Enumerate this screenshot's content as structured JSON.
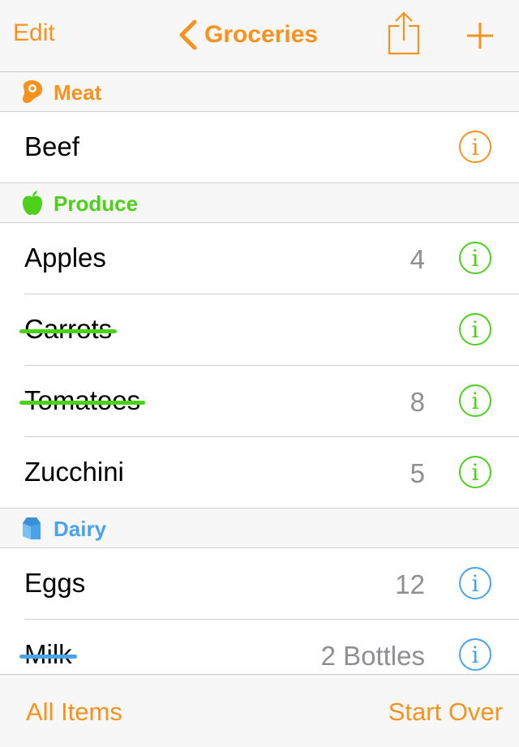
{
  "navbar": {
    "edit_label": "Edit",
    "back_icon": "chevron-left-icon",
    "title": "Groceries",
    "share_icon": "share-icon",
    "add_icon": "plus-icon"
  },
  "colors": {
    "accent": "#f7921e",
    "meat": "#f7921e",
    "produce": "#4cd01a",
    "dairy": "#4aa3e8",
    "quantity_text": "#8e8e93"
  },
  "sections": [
    {
      "title": "Meat",
      "icon": "meat-steak-icon",
      "color": "#f7921e",
      "items": [
        {
          "name": "Beef",
          "quantity": "",
          "checked": false
        }
      ]
    },
    {
      "title": "Produce",
      "icon": "apple-icon",
      "color": "#4cd01a",
      "items": [
        {
          "name": "Apples",
          "quantity": "4",
          "checked": false
        },
        {
          "name": "Carrots",
          "quantity": "",
          "checked": true
        },
        {
          "name": "Tomatoes",
          "quantity": "8",
          "checked": true
        },
        {
          "name": "Zucchini",
          "quantity": "5",
          "checked": false
        }
      ]
    },
    {
      "title": "Dairy",
      "icon": "milk-carton-icon",
      "color": "#4aa3e8",
      "items": [
        {
          "name": "Eggs",
          "quantity": "12",
          "checked": false
        },
        {
          "name": "Milk",
          "quantity": "2 Bottles",
          "checked": true
        }
      ]
    }
  ],
  "info_glyph": "i",
  "toolbar": {
    "all_items_label": "All Items",
    "start_over_label": "Start Over"
  }
}
